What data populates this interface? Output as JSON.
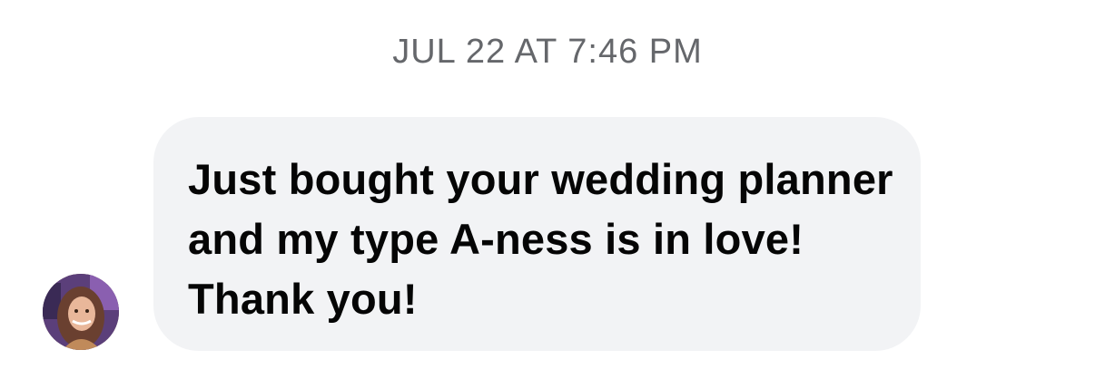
{
  "conversation": {
    "timestamp": "JUL 22 AT 7:46 PM",
    "messages": [
      {
        "sender_avatar_icon": "user-avatar-photo",
        "text": "Just bought your wedding planner and my type A-ness is in love! Thank you!"
      }
    ]
  },
  "colors": {
    "timestamp": "#65676b",
    "bubble_background": "#f2f3f5",
    "message_text": "#050505"
  }
}
